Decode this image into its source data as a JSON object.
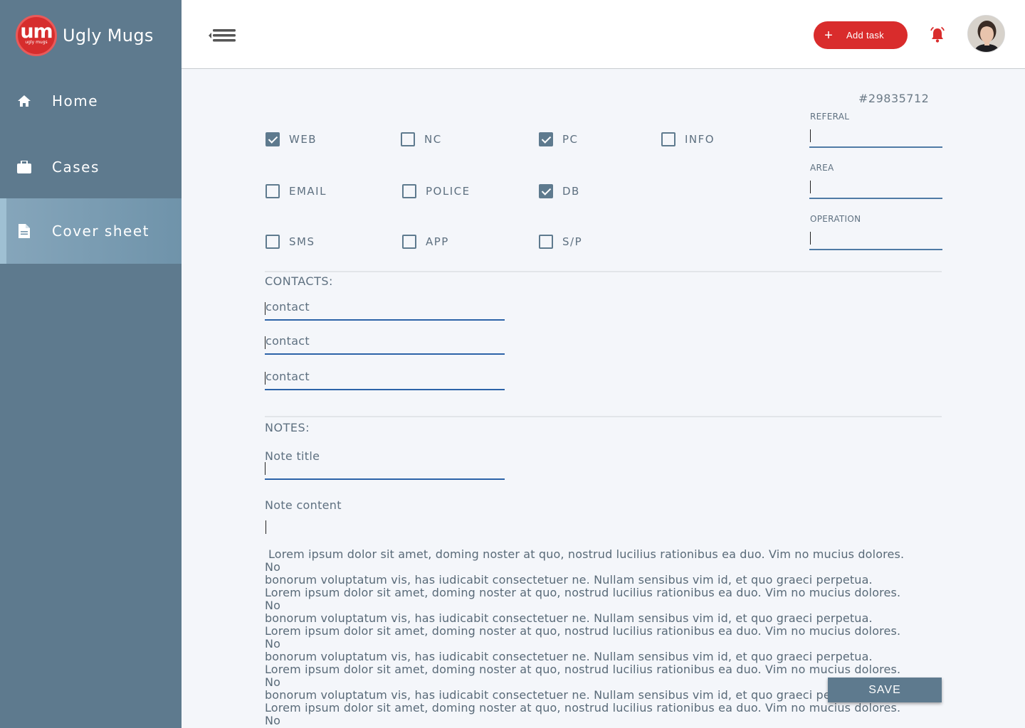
{
  "brand": {
    "logo_text": "um",
    "logo_sub": "ugly mugs",
    "name": "Ugly Mugs"
  },
  "sidebar": {
    "items": [
      {
        "label": "Home",
        "icon": "home-icon",
        "active": false
      },
      {
        "label": "Cases",
        "icon": "briefcase-icon",
        "active": false
      },
      {
        "label": "Cover sheet",
        "icon": "document-icon",
        "active": true
      }
    ]
  },
  "header": {
    "add_task_label": "Add task",
    "accent_color": "#d92c2c"
  },
  "case": {
    "id": "#29835712"
  },
  "checkboxes": [
    {
      "label": "WEB",
      "checked": true
    },
    {
      "label": "NC",
      "checked": false
    },
    {
      "label": "PC",
      "checked": true
    },
    {
      "label": "INFO",
      "checked": false
    },
    {
      "label": "EMAIL",
      "checked": false
    },
    {
      "label": "POLICE",
      "checked": false
    },
    {
      "label": "DB",
      "checked": true
    },
    {
      "label": "SMS",
      "checked": false
    },
    {
      "label": "APP",
      "checked": false
    },
    {
      "label": "S/P",
      "checked": false
    }
  ],
  "fields": {
    "referal_label": "REFERAL",
    "area_label": "AREA",
    "operation_label": "OPERATION"
  },
  "contacts": {
    "title": "CONTACTS:",
    "placeholders": [
      "contact",
      "contact",
      "contact"
    ]
  },
  "notes": {
    "title": "NOTES:",
    "note_title_placeholder": "Note title",
    "note_content_label": "Note content",
    "content": "Lorem ipsum dolor sit amet, doming noster at quo, nostrud lucilius rationibus ea duo. Vim no mucius dolores. No\nbonorum voluptatum vis, has iudicabit consectetuer ne. Nullam sensibus vim id, et quo graeci perpetua.\nLorem ipsum dolor sit amet, doming noster at quo, nostrud lucilius rationibus ea duo. Vim no mucius dolores. No\nbonorum voluptatum vis, has iudicabit consectetuer ne. Nullam sensibus vim id, et quo graeci perpetua.\nLorem ipsum dolor sit amet, doming noster at quo, nostrud lucilius rationibus ea duo. Vim no mucius dolores. No\nbonorum voluptatum vis, has iudicabit consectetuer ne. Nullam sensibus vim id, et quo graeci perpetua.\nLorem ipsum dolor sit amet, doming noster at quo, nostrud lucilius rationibus ea duo. Vim no mucius dolores. No\nbonorum voluptatum vis, has iudicabit consectetuer ne. Nullam sensibus vim id, et quo graeci perpetua.\nLorem ipsum dolor sit amet, doming noster at quo, nostrud lucilius rationibus ea duo. Vim no mucius dolores. No\nbonorum voluptatum vis, has iudicabit consectetuer ne. Nullam sensibus vim id, et quo graeci perpetua."
  },
  "save_label": "SAVE"
}
